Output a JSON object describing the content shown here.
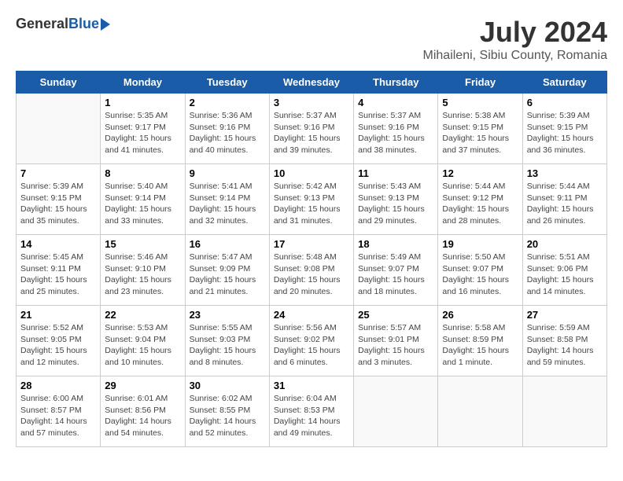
{
  "header": {
    "logo_general": "General",
    "logo_blue": "Blue",
    "month_year": "July 2024",
    "location": "Mihaileni, Sibiu County, Romania"
  },
  "days_of_week": [
    "Sunday",
    "Monday",
    "Tuesday",
    "Wednesday",
    "Thursday",
    "Friday",
    "Saturday"
  ],
  "weeks": [
    [
      {
        "day": "",
        "info": ""
      },
      {
        "day": "1",
        "info": "Sunrise: 5:35 AM\nSunset: 9:17 PM\nDaylight: 15 hours\nand 41 minutes."
      },
      {
        "day": "2",
        "info": "Sunrise: 5:36 AM\nSunset: 9:16 PM\nDaylight: 15 hours\nand 40 minutes."
      },
      {
        "day": "3",
        "info": "Sunrise: 5:37 AM\nSunset: 9:16 PM\nDaylight: 15 hours\nand 39 minutes."
      },
      {
        "day": "4",
        "info": "Sunrise: 5:37 AM\nSunset: 9:16 PM\nDaylight: 15 hours\nand 38 minutes."
      },
      {
        "day": "5",
        "info": "Sunrise: 5:38 AM\nSunset: 9:15 PM\nDaylight: 15 hours\nand 37 minutes."
      },
      {
        "day": "6",
        "info": "Sunrise: 5:39 AM\nSunset: 9:15 PM\nDaylight: 15 hours\nand 36 minutes."
      }
    ],
    [
      {
        "day": "7",
        "info": "Sunrise: 5:39 AM\nSunset: 9:15 PM\nDaylight: 15 hours\nand 35 minutes."
      },
      {
        "day": "8",
        "info": "Sunrise: 5:40 AM\nSunset: 9:14 PM\nDaylight: 15 hours\nand 33 minutes."
      },
      {
        "day": "9",
        "info": "Sunrise: 5:41 AM\nSunset: 9:14 PM\nDaylight: 15 hours\nand 32 minutes."
      },
      {
        "day": "10",
        "info": "Sunrise: 5:42 AM\nSunset: 9:13 PM\nDaylight: 15 hours\nand 31 minutes."
      },
      {
        "day": "11",
        "info": "Sunrise: 5:43 AM\nSunset: 9:13 PM\nDaylight: 15 hours\nand 29 minutes."
      },
      {
        "day": "12",
        "info": "Sunrise: 5:44 AM\nSunset: 9:12 PM\nDaylight: 15 hours\nand 28 minutes."
      },
      {
        "day": "13",
        "info": "Sunrise: 5:44 AM\nSunset: 9:11 PM\nDaylight: 15 hours\nand 26 minutes."
      }
    ],
    [
      {
        "day": "14",
        "info": "Sunrise: 5:45 AM\nSunset: 9:11 PM\nDaylight: 15 hours\nand 25 minutes."
      },
      {
        "day": "15",
        "info": "Sunrise: 5:46 AM\nSunset: 9:10 PM\nDaylight: 15 hours\nand 23 minutes."
      },
      {
        "day": "16",
        "info": "Sunrise: 5:47 AM\nSunset: 9:09 PM\nDaylight: 15 hours\nand 21 minutes."
      },
      {
        "day": "17",
        "info": "Sunrise: 5:48 AM\nSunset: 9:08 PM\nDaylight: 15 hours\nand 20 minutes."
      },
      {
        "day": "18",
        "info": "Sunrise: 5:49 AM\nSunset: 9:07 PM\nDaylight: 15 hours\nand 18 minutes."
      },
      {
        "day": "19",
        "info": "Sunrise: 5:50 AM\nSunset: 9:07 PM\nDaylight: 15 hours\nand 16 minutes."
      },
      {
        "day": "20",
        "info": "Sunrise: 5:51 AM\nSunset: 9:06 PM\nDaylight: 15 hours\nand 14 minutes."
      }
    ],
    [
      {
        "day": "21",
        "info": "Sunrise: 5:52 AM\nSunset: 9:05 PM\nDaylight: 15 hours\nand 12 minutes."
      },
      {
        "day": "22",
        "info": "Sunrise: 5:53 AM\nSunset: 9:04 PM\nDaylight: 15 hours\nand 10 minutes."
      },
      {
        "day": "23",
        "info": "Sunrise: 5:55 AM\nSunset: 9:03 PM\nDaylight: 15 hours\nand 8 minutes."
      },
      {
        "day": "24",
        "info": "Sunrise: 5:56 AM\nSunset: 9:02 PM\nDaylight: 15 hours\nand 6 minutes."
      },
      {
        "day": "25",
        "info": "Sunrise: 5:57 AM\nSunset: 9:01 PM\nDaylight: 15 hours\nand 3 minutes."
      },
      {
        "day": "26",
        "info": "Sunrise: 5:58 AM\nSunset: 8:59 PM\nDaylight: 15 hours\nand 1 minute."
      },
      {
        "day": "27",
        "info": "Sunrise: 5:59 AM\nSunset: 8:58 PM\nDaylight: 14 hours\nand 59 minutes."
      }
    ],
    [
      {
        "day": "28",
        "info": "Sunrise: 6:00 AM\nSunset: 8:57 PM\nDaylight: 14 hours\nand 57 minutes."
      },
      {
        "day": "29",
        "info": "Sunrise: 6:01 AM\nSunset: 8:56 PM\nDaylight: 14 hours\nand 54 minutes."
      },
      {
        "day": "30",
        "info": "Sunrise: 6:02 AM\nSunset: 8:55 PM\nDaylight: 14 hours\nand 52 minutes."
      },
      {
        "day": "31",
        "info": "Sunrise: 6:04 AM\nSunset: 8:53 PM\nDaylight: 14 hours\nand 49 minutes."
      },
      {
        "day": "",
        "info": ""
      },
      {
        "day": "",
        "info": ""
      },
      {
        "day": "",
        "info": ""
      }
    ]
  ]
}
